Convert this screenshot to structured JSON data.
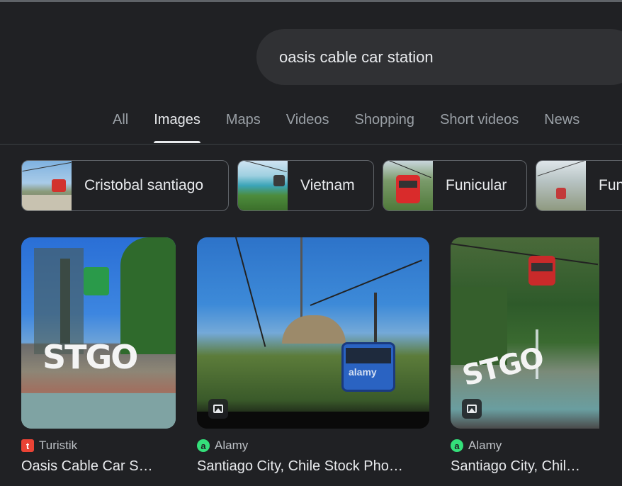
{
  "search": {
    "query": "oasis cable car station"
  },
  "tabs": [
    {
      "label": "All",
      "active": false
    },
    {
      "label": "Images",
      "active": true
    },
    {
      "label": "Maps",
      "active": false
    },
    {
      "label": "Videos",
      "active": false
    },
    {
      "label": "Shopping",
      "active": false
    },
    {
      "label": "Short videos",
      "active": false
    },
    {
      "label": "News",
      "active": false
    }
  ],
  "chips": [
    {
      "label": "Cristobal santiago"
    },
    {
      "label": "Vietnam"
    },
    {
      "label": "Funicular"
    },
    {
      "label": "Fun"
    }
  ],
  "results": [
    {
      "source": "Turistik",
      "favicon": "t",
      "title": "Oasis Cable Car S…",
      "image_text": "STGO"
    },
    {
      "source": "Alamy",
      "favicon": "a",
      "title": "Santiago City, Chile Stock Pho…",
      "watermark": "alamy"
    },
    {
      "source": "Alamy",
      "favicon": "a",
      "title": "Santiago City, Chil…",
      "image_text": "STGO"
    }
  ],
  "colors": {
    "background": "#202124",
    "search_bg": "#303134",
    "alamy_green": "#34e07a",
    "turistik_red": "#ea4335"
  }
}
